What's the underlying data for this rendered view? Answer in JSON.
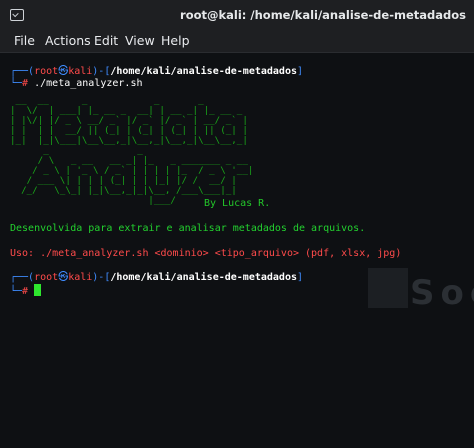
{
  "window": {
    "title": "root@kali: /home/kali/analise-de-metadados"
  },
  "menu": {
    "items": [
      "File",
      "Actions",
      "Edit",
      "View",
      "Help"
    ]
  },
  "prompt": {
    "open": "┌──(",
    "user": "root",
    "at_symbol": "㉿",
    "host": "kali",
    "mid": ")-[",
    "path": "/home/kali/analise-de-metadados",
    "close": "]",
    "second_line_prefix": "└─",
    "hash": "#"
  },
  "session": {
    "command1": "./meta_analyzer.sh",
    "banner_ascii": " __  __      _            _       _        \n|  \\/  | ___| |_ __ _  __| | __ _| |_ __ _ \n| |\\/| |/ _ \\ __/ _` |/ _` |/ _` | __/ _` |\n| |  | |  __/ || (_| | (_| | (_| | || (_| |\n|_|  |_|\\___|\\__\\__,_|\\__,_|\\__,_|\\__\\__,_|\n      _                _                    \n     / \\   _ __   __ _| |_   _ _______ _ __ \n    / _ \\ | '_ \\ / _` | | | | |_  / _ \\ '__|\n   / ___ \\| | | | (_| | | |_| |/ /  __/ |   \n  /_/   \\_\\_| |_|\\__,_|_|\\__, /___\\___|_|   \n                         |___/              ",
    "banner_credit": "By Lucas R.",
    "description": "Desenvolvida para extrair e analisar metadados de arquivos.",
    "usage": "Uso: ./meta_analyzer.sh <dominio> <tipo_arquivo> (pdf, xlsx, jpg)"
  },
  "background_logo_text": "Societ",
  "colors": {
    "prompt_blue": "#3f8cff",
    "prompt_red": "#ff4b4b",
    "banner_green": "#1aa81a",
    "cursor_green": "#2ee62e"
  }
}
